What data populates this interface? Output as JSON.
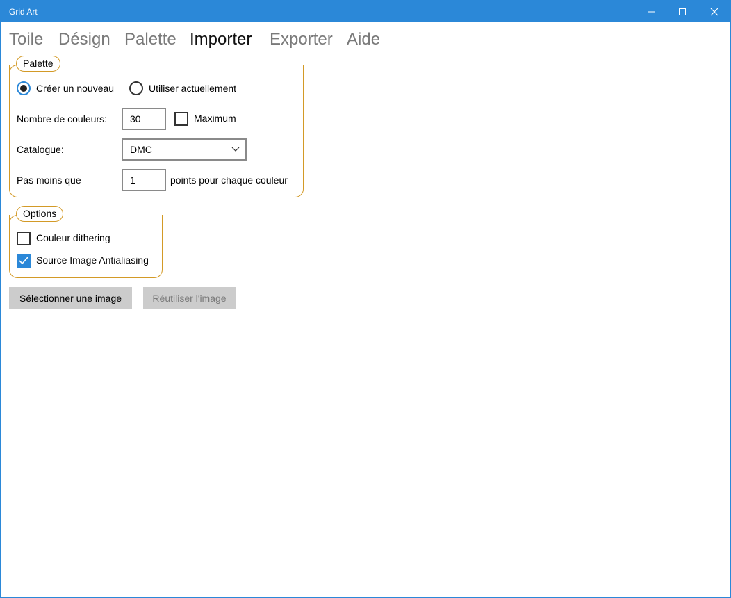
{
  "window": {
    "title": "Grid Art"
  },
  "menu": {
    "items": [
      "Toile",
      "Désign",
      "Palette",
      "Importer",
      "Exporter",
      "Aide"
    ],
    "active_index": 3
  },
  "palette_group": {
    "legend": "Palette",
    "radio_create": "Créer un nouveau",
    "radio_use_current": "Utiliser actuellement",
    "selected_radio": "create",
    "color_count_label": "Nombre de couleurs:",
    "color_count_value": "30",
    "maximum_label": "Maximum",
    "maximum_checked": false,
    "catalog_label": "Catalogue:",
    "catalog_value": "DMC",
    "min_points_label": "Pas moins que",
    "min_points_value": "1",
    "min_points_suffix": "points pour chaque couleur"
  },
  "options_group": {
    "legend": "Options",
    "dithering_label": "Couleur dithering",
    "dithering_checked": false,
    "antialias_label": "Source Image Antialiasing",
    "antialias_checked": true
  },
  "actions": {
    "select_image": "Sélectionner une image",
    "reuse_image": "Réutiliser l'image"
  },
  "colors": {
    "accent": "#2b88d8",
    "group_border": "#d39a27",
    "button_bg": "#cccccc"
  },
  "icons": {
    "minimize": "minimize-icon",
    "maximize": "maximize-icon",
    "close": "close-icon",
    "dropdown": "chevron-down-icon",
    "check": "checkmark-icon"
  }
}
